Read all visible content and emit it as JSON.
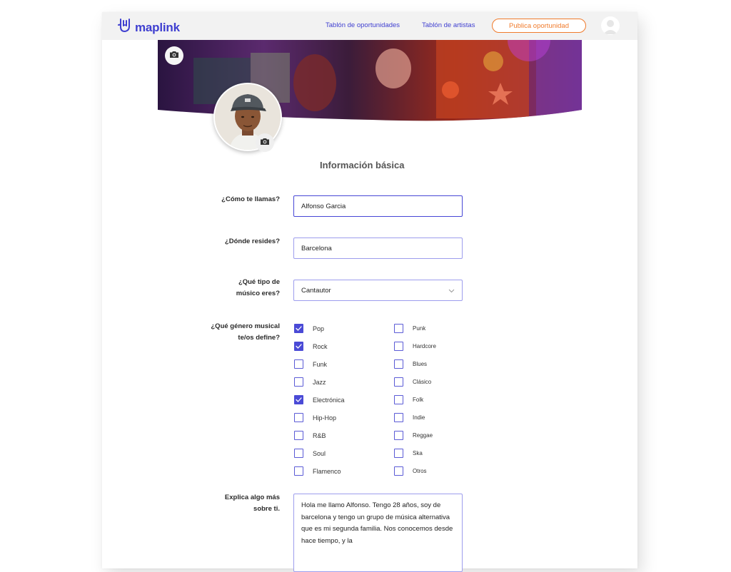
{
  "header": {
    "brand": "maplink",
    "logo_icon": "rock-hand-icon",
    "nav": {
      "opportunities": "Tablón de oportunidades",
      "artists": "Tablón de artistas"
    },
    "publish_button": "Publica oportunidad",
    "avatar_icon": "user-avatar-icon"
  },
  "colors": {
    "brand": "#3f3fd0",
    "accent": "#f07b2c",
    "checkbox": "#4a4ad6"
  },
  "cover": {
    "camera_icon": "camera-icon"
  },
  "section_title": "Información básica",
  "form": {
    "name": {
      "label": "¿Cómo te llamas?",
      "value": "Alfonso Garcia"
    },
    "location": {
      "label": "¿Dónde resides?",
      "value": "Barcelona"
    },
    "musician_type": {
      "label_line1": "¿Qué tipo de",
      "label_line2": "músico eres?",
      "value": "Cantautor"
    },
    "genres": {
      "label_line1": "¿Qué género musical",
      "label_line2": "te/os define?",
      "left": [
        {
          "label": "Pop",
          "checked": true
        },
        {
          "label": "Rock",
          "checked": true
        },
        {
          "label": "Funk",
          "checked": false
        },
        {
          "label": "Jazz",
          "checked": false
        },
        {
          "label": "Electrónica",
          "checked": true
        },
        {
          "label": "Hip-Hop",
          "checked": false
        },
        {
          "label": "R&B",
          "checked": false
        },
        {
          "label": "Soul",
          "checked": false
        },
        {
          "label": "Flamenco",
          "checked": false
        }
      ],
      "right": [
        {
          "label": "Punk",
          "checked": false
        },
        {
          "label": "Hardcore",
          "checked": false
        },
        {
          "label": "Blues",
          "checked": false
        },
        {
          "label": "Clásico",
          "checked": false
        },
        {
          "label": "Folk",
          "checked": false
        },
        {
          "label": "Indie",
          "checked": false
        },
        {
          "label": "Reggae",
          "checked": false
        },
        {
          "label": "Ska",
          "checked": false
        },
        {
          "label": "Otros",
          "checked": false
        }
      ]
    },
    "about": {
      "label_line1": "Explica algo más",
      "label_line2": "sobre ti.",
      "value": "Hola me llamo Alfonso. Tengo 28 años, soy de barcelona y tengo un grupo de música alternativa que es mi segunda familia. Nos conocemos desde hace tiempo, y la"
    }
  }
}
